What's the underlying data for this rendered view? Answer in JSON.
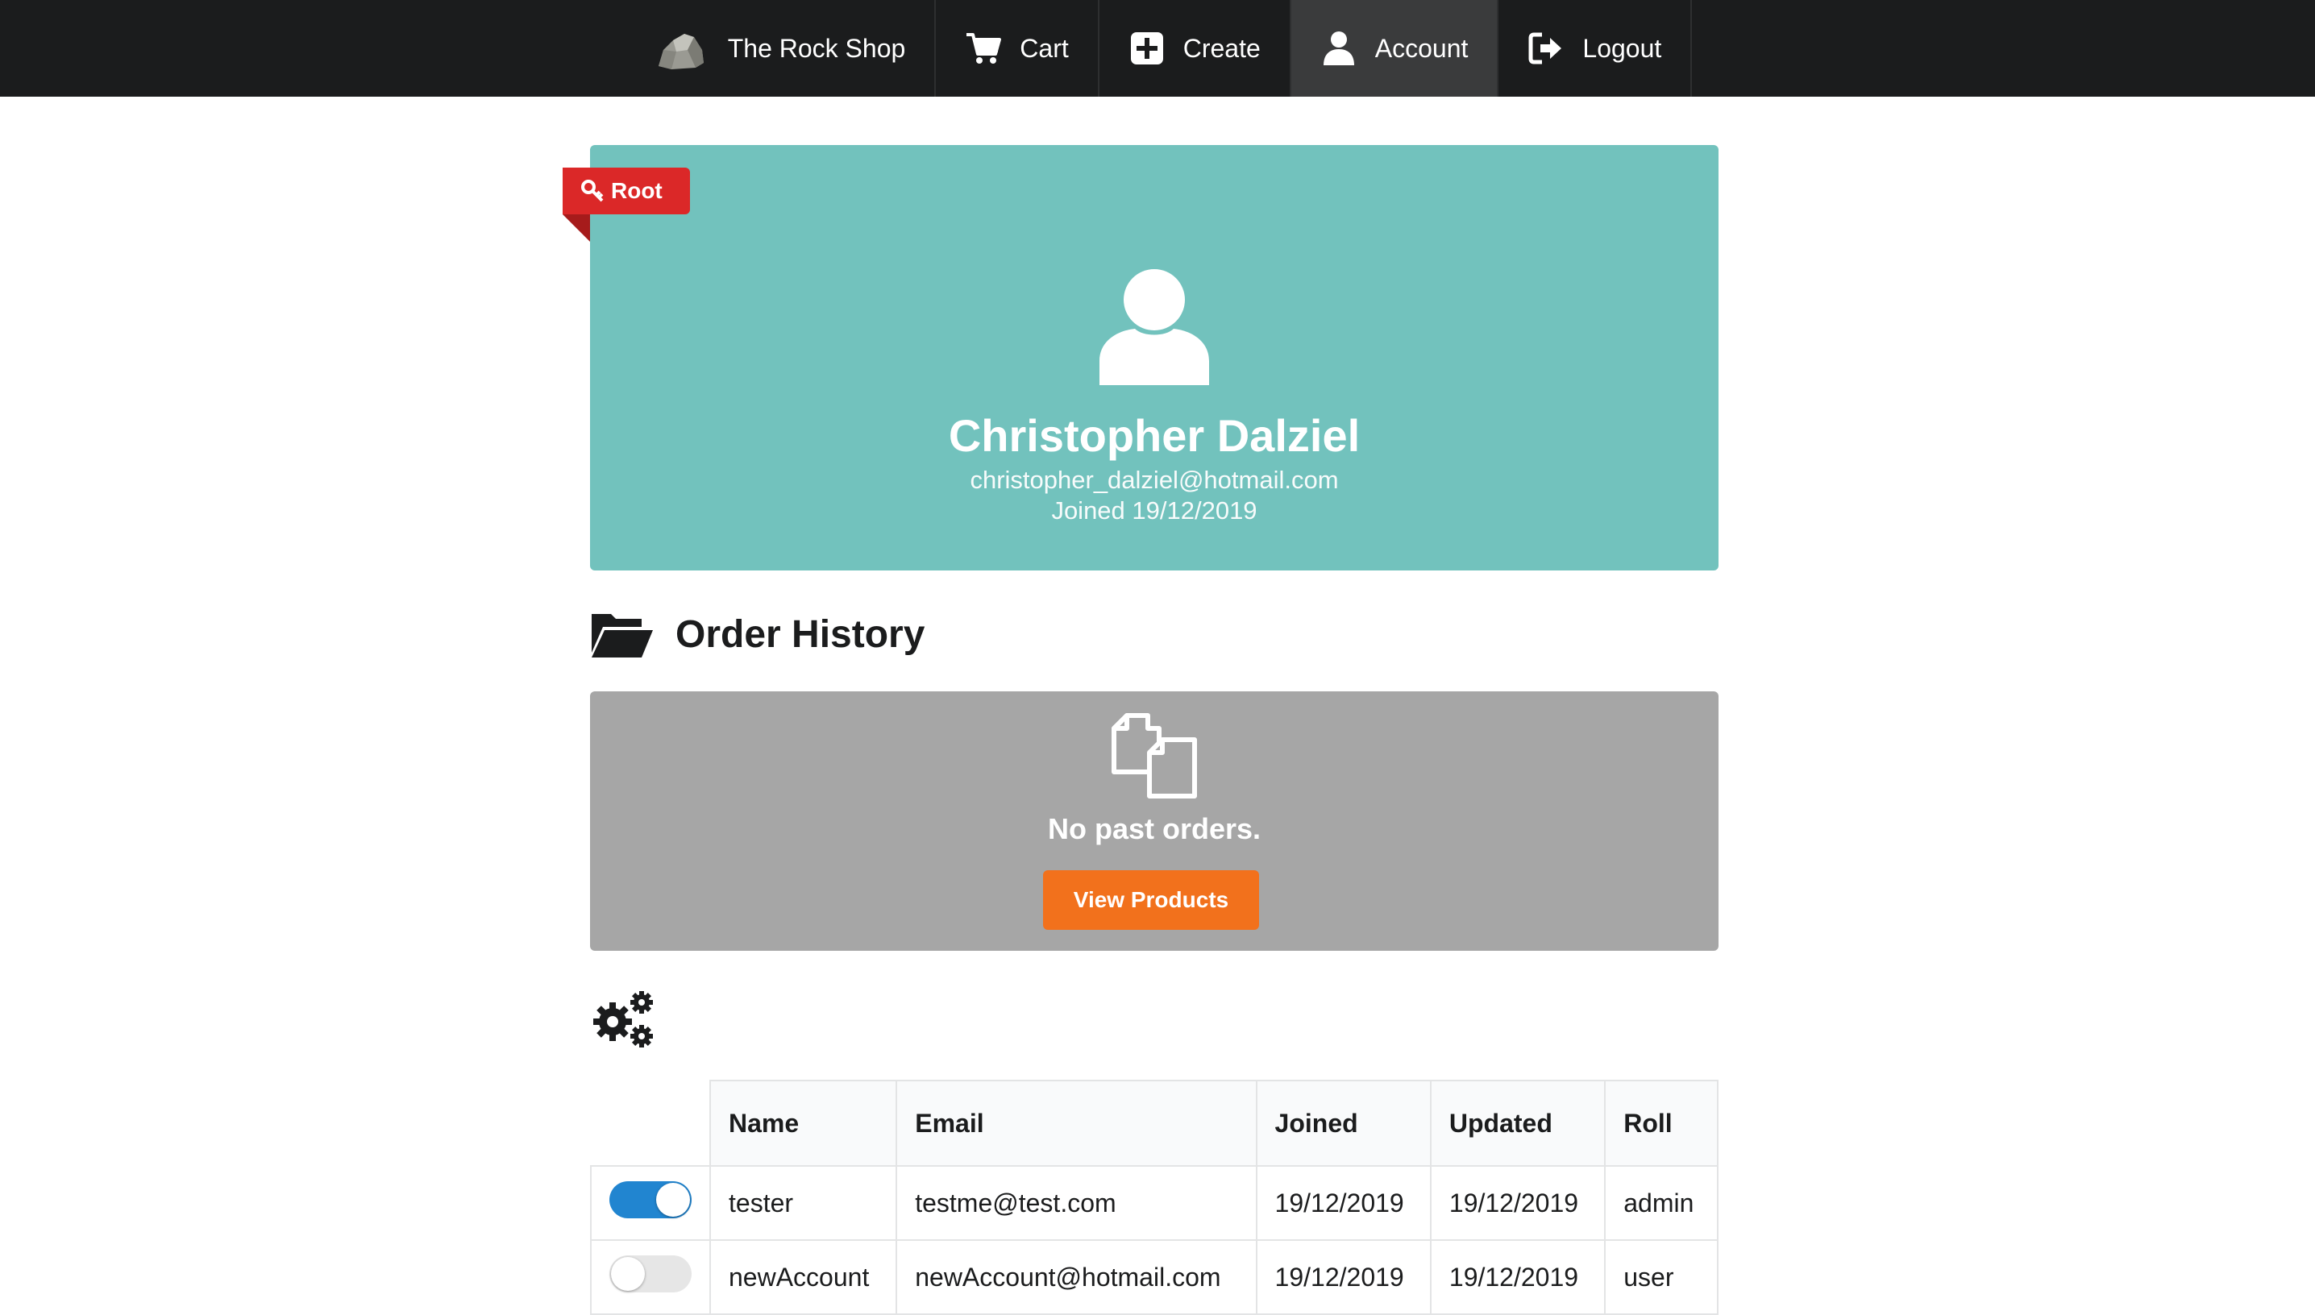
{
  "nav": {
    "brand_label": "The Rock Shop",
    "brand_icon": "rock-icon",
    "items": [
      {
        "label": "Cart",
        "icon": "cart-icon"
      },
      {
        "label": "Create",
        "icon": "plus-square-icon"
      },
      {
        "label": "Account",
        "icon": "user-icon",
        "active": true
      },
      {
        "label": "Logout",
        "icon": "sign-out-icon"
      }
    ]
  },
  "profile": {
    "role_badge": "Root",
    "role_icon": "key-icon",
    "name": "Christopher Dalziel",
    "email": "christopher_dalziel@hotmail.com",
    "joined": "Joined 19/12/2019",
    "card_color": "#72c2bd"
  },
  "orders": {
    "title": "Order History",
    "empty_message": "No past orders.",
    "view_products_label": "View Products",
    "button_color": "#f2711c"
  },
  "admin": {
    "icon": "cogs-icon",
    "columns": [
      "Name",
      "Email",
      "Joined",
      "Updated",
      "Roll"
    ],
    "rows": [
      {
        "enabled": true,
        "name": "tester",
        "email": "testme@test.com",
        "joined": "19/12/2019",
        "updated": "19/12/2019",
        "roll": "admin"
      },
      {
        "enabled": false,
        "name": "newAccount",
        "email": "newAccount@hotmail.com",
        "joined": "19/12/2019",
        "updated": "19/12/2019",
        "roll": "user"
      }
    ]
  }
}
